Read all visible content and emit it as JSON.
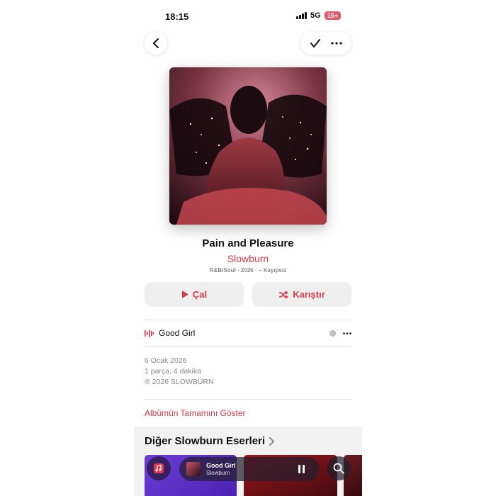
{
  "status": {
    "time": "18:15",
    "network": "5G",
    "battery": "15+"
  },
  "album": {
    "title": "Pain and Pleasure",
    "artist": "Slowburn",
    "meta": "R&B/Soul · 2026 · ⌁ Kayıpsız"
  },
  "actions": {
    "play": "Çal",
    "shuffle": "Karıştır"
  },
  "tracks": [
    {
      "title": "Good Girl"
    }
  ],
  "info": {
    "release_date": "6 Ocak 2026",
    "summary": "1 parça, 4 dakika",
    "copyright": "℗ 2026 SLOWBURN"
  },
  "show_all": "Albümün Tamamını Göster",
  "more_section": {
    "title": "Diğer Slowburn Eserleri"
  },
  "mini_player": {
    "title": "Good Girl",
    "artist": "Slowburn"
  },
  "colors": {
    "accent": "#e0394e",
    "battery": "#e25a6a"
  },
  "icons": [
    "back-icon",
    "checkmark-icon",
    "more-icon",
    "play-icon",
    "shuffle-icon",
    "waveform-icon",
    "download-icon",
    "chevron-right-icon",
    "music-library-icon",
    "pause-icon",
    "search-icon"
  ]
}
